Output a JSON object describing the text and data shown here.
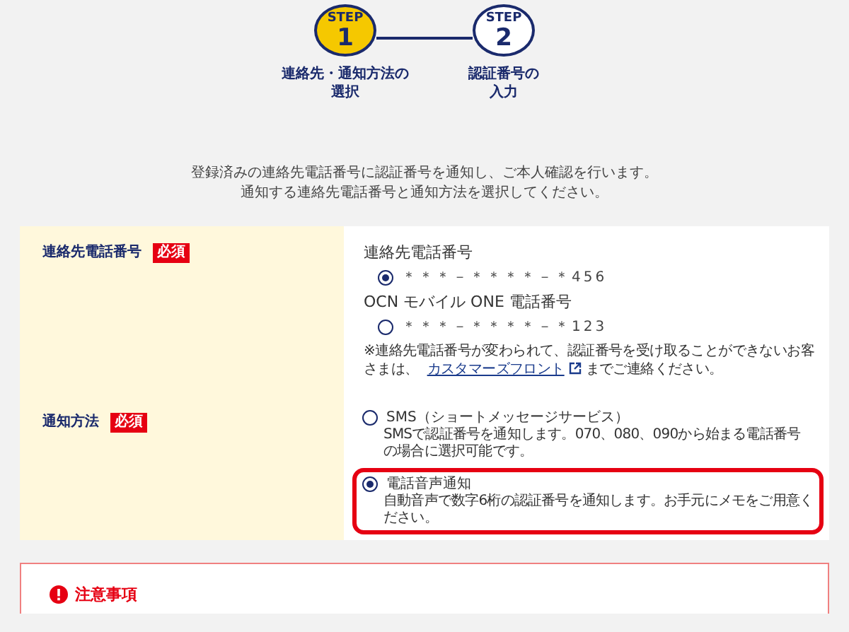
{
  "steps": [
    {
      "tag": "STEP",
      "number": "1",
      "caption_lines": [
        "連絡先・通知方法の",
        "選択"
      ],
      "selected": true
    },
    {
      "tag": "STEP",
      "number": "2",
      "caption_lines": [
        "認証番号の",
        "入力"
      ],
      "selected": false
    }
  ],
  "intro": [
    "登録済みの連絡先電話番号に認証番号を通知し、ご本人確認を行います。",
    "通知する連絡先電話番号と通知方法を選択してください。"
  ],
  "rows": [
    {
      "kind": "phone",
      "label": "連絡先電話番号",
      "badge": "必須",
      "groups": [
        {
          "heading": "連絡先電話番号",
          "number": "＊＊＊－＊＊＊＊－＊456",
          "selected": true
        },
        {
          "heading": "OCN モバイル ONE 電話番号",
          "number": "＊＊＊－＊＊＊＊－＊123",
          "selected": false
        }
      ],
      "note": {
        "before": "※連絡先電話番号が変わられて、認証番号を受け取ることができないお客さまは、",
        "link": "カスタマーズフロント",
        "after": "までご連絡ください。"
      }
    },
    {
      "kind": "method",
      "label": "通知方法",
      "badge": "必須",
      "options": [
        {
          "label": "SMS（ショートメッセージサービス）",
          "description": "SMSで認証番号を通知します。070、080、090から始まる電話番号の場合に選択可能です。",
          "selected": false,
          "highlighted": false
        },
        {
          "label": "電話音声通知",
          "description": "自動音声で数字6桁の認証番号を通知します。お手元にメモをご用意ください。",
          "selected": true,
          "highlighted": true
        }
      ]
    }
  ],
  "caution": {
    "title": "注意事項"
  }
}
